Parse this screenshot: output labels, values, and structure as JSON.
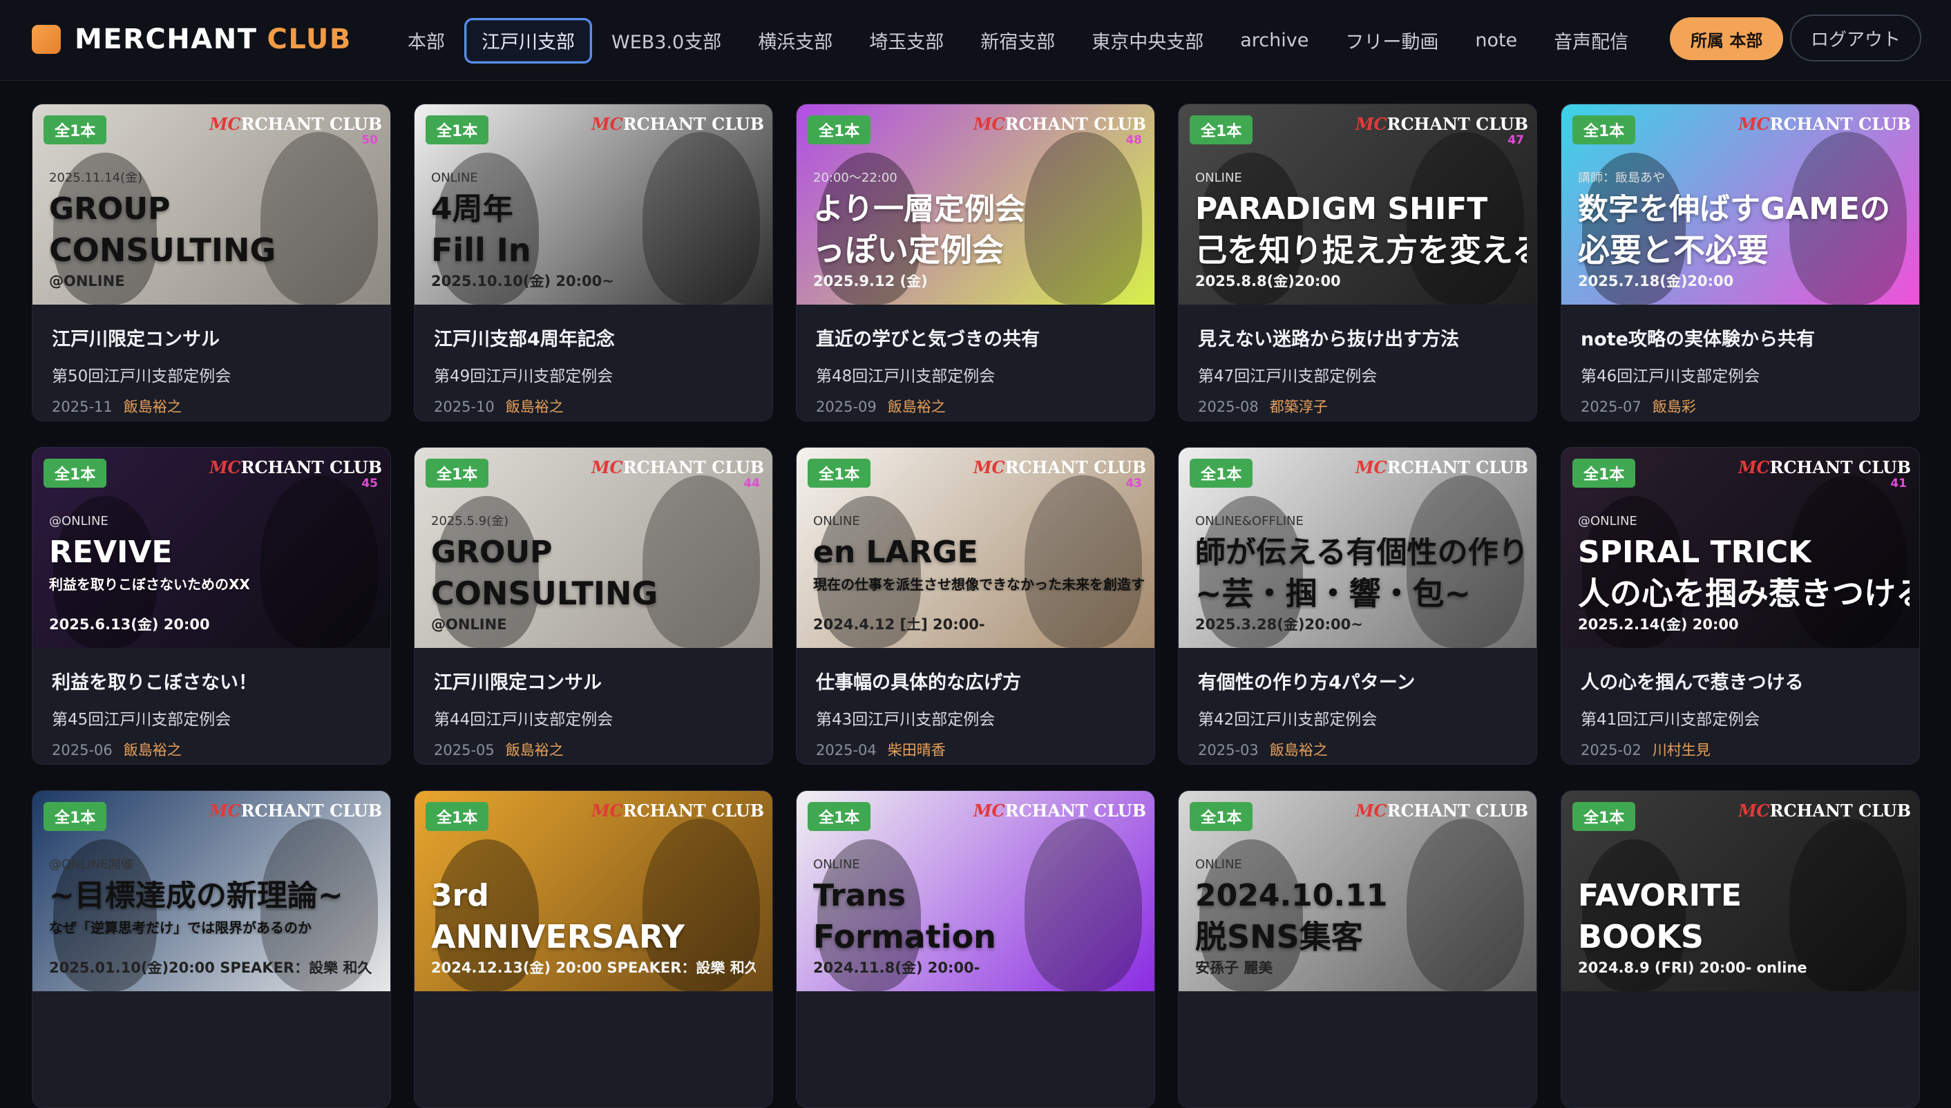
{
  "header": {
    "logo_word1": "MERCHANT",
    "logo_word2": "CLUB",
    "nav": [
      "本部",
      "江戸川支部",
      "WEB3.0支部",
      "横浜支部",
      "埼玉支部",
      "新宿支部",
      "東京中央支部",
      "archive",
      "フリー動画",
      "note",
      "音声配信"
    ],
    "active_nav": "江戸川支部",
    "affiliation_button": "所属 本部",
    "logout_button": "ログアウト"
  },
  "badge_label": "全1本",
  "cards": [
    {
      "title": "江戸川限定コンサル",
      "subtitle": "第50回江戸川支部定例会",
      "date": "2025-11",
      "author": "飯島裕之",
      "thumb": {
        "big1": "GROUP",
        "big2": "CONSULTING",
        "sm1": "@ONLINE",
        "sm2": "2025.11.14(金)",
        "num": "50",
        "bg": [
          "#d9d6cf",
          "#8e8a82"
        ]
      }
    },
    {
      "title": "江戸川支部4周年記念",
      "subtitle": "第49回江戸川支部定例会",
      "date": "2025-10",
      "author": "飯島裕之",
      "thumb": {
        "big1": "4周年",
        "big2": "Fill In",
        "sm1": "2025.10.10(金) 20:00~",
        "sm2": "ONLINE",
        "num": "",
        "bg": [
          "#f1f1f1",
          "#2b2b2b"
        ]
      }
    },
    {
      "title": "直近の学びと気づきの共有",
      "subtitle": "第48回江戸川支部定例会",
      "date": "2025-09",
      "author": "飯島裕之",
      "thumb": {
        "big1": "より一層定例会",
        "big2": "っぽい定例会",
        "sm1": "2025.9.12 (金)",
        "sm2": "20:00～22:00",
        "num": "48",
        "bg": [
          "#b04ee6",
          "#d7f04a"
        ]
      }
    },
    {
      "title": "見えない迷路から抜け出す方法",
      "subtitle": "第47回江戸川支部定例会",
      "date": "2025-08",
      "author": "都築淳子",
      "thumb": {
        "big1": "PARADIGM SHIFT",
        "big2": "己を知り捉え方を変えることが",
        "sm1": "2025.8.8(金)20:00",
        "sm2": "ONLINE",
        "num": "47",
        "bg": [
          "#4a4a4a",
          "#1e1e1e"
        ]
      }
    },
    {
      "title": "note攻略の実体験から共有",
      "subtitle": "第46回江戸川支部定例会",
      "date": "2025-07",
      "author": "飯島彩",
      "thumb": {
        "big1": "数字を伸ばすGAMEの",
        "big2": "必要と不必要",
        "sm1": "2025.7.18(金)20:00",
        "sm2": "講師：飯島あや",
        "num": "",
        "bg": [
          "#3ad3e8",
          "#ee52d8"
        ]
      }
    },
    {
      "title": "利益を取りこぼさない！",
      "subtitle": "第45回江戸川支部定例会",
      "date": "2025-06",
      "author": "飯島裕之",
      "thumb": {
        "big1": "REVIVE",
        "big2": "利益を取りこぼさないためのXX",
        "sm1": "2025.6.13(金) 20:00",
        "sm2": "@ONLINE",
        "num": "45",
        "bg": [
          "#2d1a3f",
          "#0d0d12"
        ]
      }
    },
    {
      "title": "江戸川限定コンサル",
      "subtitle": "第44回江戸川支部定例会",
      "date": "2025-05",
      "author": "飯島裕之",
      "thumb": {
        "big1": "GROUP",
        "big2": "CONSULTING",
        "sm1": "@ONLINE",
        "sm2": "2025.5.9(金)",
        "num": "44",
        "bg": [
          "#e0ded8",
          "#9c9890"
        ]
      }
    },
    {
      "title": "仕事幅の具体的な広げ方",
      "subtitle": "第43回江戸川支部定例会",
      "date": "2025-04",
      "author": "柴田晴香",
      "thumb": {
        "big1": "en LARGE",
        "big2": "現在の仕事を派生させ想像できなかった未来を創造する",
        "sm1": "2024.4.12 [土] 20:00-",
        "sm2": "ONLINE",
        "num": "43",
        "bg": [
          "#f4f2ee",
          "#a3886a"
        ]
      }
    },
    {
      "title": "有個性の作り方4パターン",
      "subtitle": "第42回江戸川支部定例会",
      "date": "2025-03",
      "author": "飯島裕之",
      "thumb": {
        "big1": "師が伝える有個性の作り方",
        "big2": "~芸・掴・響・包~",
        "sm1": "2025.3.28(金)20:00~",
        "sm2": "ONLINE&OFFLINE",
        "num": "",
        "bg": [
          "#eeeeee",
          "#6e6e6e"
        ]
      }
    },
    {
      "title": "人の心を掴んで惹きつける",
      "subtitle": "第41回江戸川支部定例会",
      "date": "2025-02",
      "author": "川村生見",
      "thumb": {
        "big1": "SPIRAL TRICK",
        "big2": "人の心を掴み惹きつける",
        "sm1": "2025.2.14(金) 20:00",
        "sm2": "@ONLINE",
        "num": "41",
        "bg": [
          "#2a1e2e",
          "#0b0b10"
        ]
      }
    },
    {
      "title": "",
      "subtitle": "",
      "date": "",
      "author": "",
      "thumb": {
        "big1": "~目標達成の新理論~",
        "big2": "なぜ「逆算思考だけ」では限界があるのか",
        "sm1": "2025.01.10(金)20:00  SPEAKER：設樂 和久",
        "sm2": "@ONLINE開催",
        "num": "",
        "bg": [
          "#1c3a66",
          "#e8e8e8"
        ]
      }
    },
    {
      "title": "",
      "subtitle": "",
      "date": "",
      "author": "",
      "thumb": {
        "big1": "3rd",
        "big2": "ANNIVERSARY",
        "sm1": "2024.12.13(金) 20:00  SPEAKER：設樂 和久",
        "sm2": "",
        "num": "",
        "bg": [
          "#e9a62e",
          "#6e4a16"
        ]
      }
    },
    {
      "title": "",
      "subtitle": "",
      "date": "",
      "author": "",
      "thumb": {
        "big1": "Trans",
        "big2": "Formation",
        "sm1": "2024.11.8(金) 20:00-",
        "sm2": "ONLINE",
        "num": "",
        "bg": [
          "#f0f0f0",
          "#8a2be2"
        ]
      }
    },
    {
      "title": "",
      "subtitle": "",
      "date": "",
      "author": "",
      "thumb": {
        "big1": "2024.10.11",
        "big2": "脱SNS集客",
        "sm1": "安孫子 麗美",
        "sm2": "ONLINE",
        "num": "",
        "bg": [
          "#d8d8d8",
          "#5a5a5a"
        ]
      }
    },
    {
      "title": "",
      "subtitle": "",
      "date": "",
      "author": "",
      "thumb": {
        "big1": "FAVORITE",
        "big2": "BOOKS",
        "sm1": "2024.8.9 (FRI) 20:00-   online",
        "sm2": "",
        "num": "",
        "bg": [
          "#3c3c3c",
          "#161616"
        ]
      }
    }
  ],
  "brand_text": "MERCHANT CLUB"
}
